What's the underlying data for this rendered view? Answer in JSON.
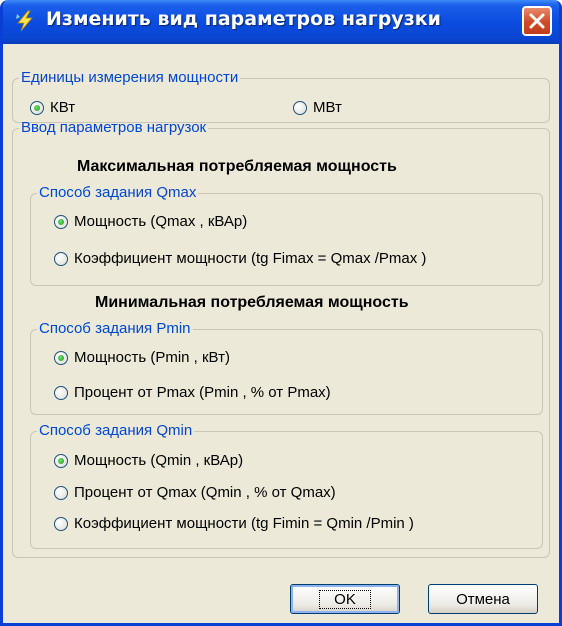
{
  "window": {
    "title": "Изменить вид параметров нагрузки"
  },
  "units": {
    "legend": "Единицы измерения мощности",
    "options": [
      "КВт",
      "МВт"
    ],
    "selected": "КВт"
  },
  "input": {
    "legend": "Ввод параметров нагрузок",
    "max_heading": "Максимальная потребляемая мощность",
    "qmax": {
      "legend": "Способ задания Qmax",
      "options": [
        "Мощность (Qmax , кВАр)",
        "Коэффициент мощности (tg Fimax = Qmax /Pmax )"
      ],
      "selected": 0
    },
    "min_heading": "Минимальная потребляемая мощность",
    "pmin": {
      "legend": "Способ задания Pmin",
      "options": [
        "Мощность (Pmin , кВт)",
        "Процент от Pmax (Pmin , % от Pmax)"
      ],
      "selected": 0
    },
    "qmin": {
      "legend": "Способ задания Qmin",
      "options": [
        "Мощность (Qmin , кВАр)",
        "Процент от Qmax (Qmin , % от Qmax)",
        "Коэффициент мощности (tg Fimin = Qmin /Pmin )"
      ],
      "selected": 0
    }
  },
  "buttons": {
    "ok": "OK",
    "cancel": "Отмена"
  },
  "colors": {
    "titlebar": "#0b4ce0",
    "legend": "#0046d5",
    "face": "#ece9d8"
  },
  "icons": {
    "title": "lightning-icon",
    "close": "close-icon"
  }
}
